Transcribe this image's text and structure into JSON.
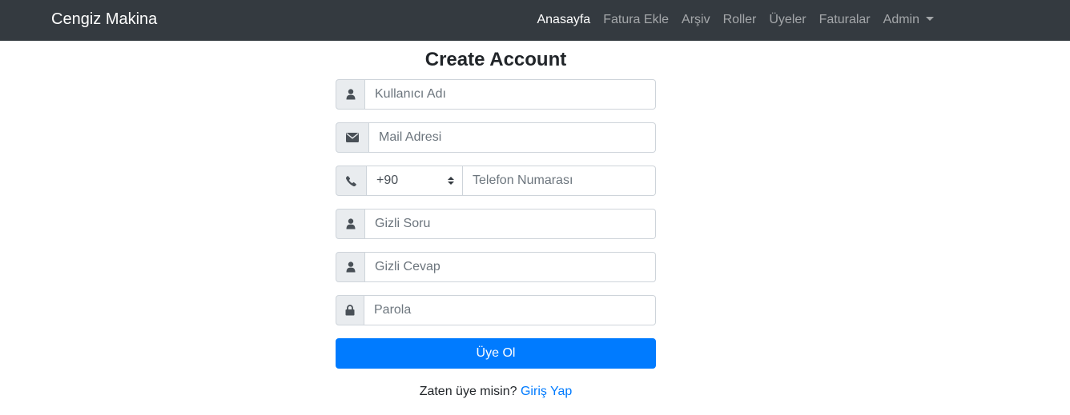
{
  "navbar": {
    "brand": "Cengiz Makina",
    "links": [
      "Anasayfa",
      "Fatura Ekle",
      "Arşiv",
      "Roller",
      "Üyeler",
      "Faturalar",
      "Admin"
    ],
    "active": "Anasayfa"
  },
  "form": {
    "title": "Create Account",
    "username_placeholder": "Kullanıcı Adı",
    "email_placeholder": "Mail Adresi",
    "country_code": "+90",
    "phone_placeholder": "Telefon Numarası",
    "secret_question_placeholder": "Gizli Soru",
    "secret_answer_placeholder": "Gizli Cevap",
    "password_placeholder": "Parola",
    "submit_label": "Üye Ol",
    "login_prompt": "Zaten üye misin?",
    "login_link": "Giriş Yap"
  },
  "icons": {
    "username": "user-icon",
    "email": "envelope-icon",
    "phone": "phone-icon",
    "secret_question": "user-icon",
    "secret_answer": "user-icon",
    "password": "lock-icon"
  },
  "colors": {
    "navbar_bg": "#343a40",
    "primary": "#007bff",
    "addon_bg": "#e9ecef",
    "border": "#ced4da"
  }
}
